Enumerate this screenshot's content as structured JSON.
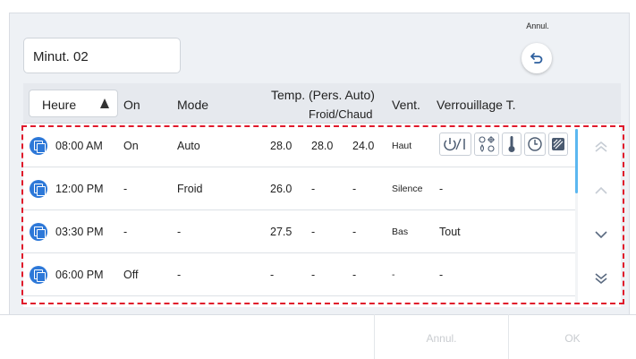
{
  "timer_name": "Minut. 02",
  "back": {
    "label": "Annul."
  },
  "header": {
    "sort_label": "Heure",
    "on": "On",
    "mode": "Mode",
    "temp_line1": "Temp. (Pers. Auto)",
    "temp_line2": "Froid/Chaud",
    "vent": "Vent.",
    "lock": "Verrouillage T."
  },
  "rows": [
    {
      "time": "08:00 AM",
      "on": "On",
      "mode": "Auto",
      "t1": "28.0",
      "t2": "28.0",
      "t3": "24.0",
      "vent": "Haut",
      "lock": ""
    },
    {
      "time": "12:00 PM",
      "on": "-",
      "mode": "Froid",
      "t1": "26.0",
      "t2": "-",
      "t3": "-",
      "vent": "Silence",
      "lock": "-"
    },
    {
      "time": "03:30 PM",
      "on": "-",
      "mode": "-",
      "t1": "27.5",
      "t2": "-",
      "t3": "-",
      "vent": "Bas",
      "lock": "Tout"
    },
    {
      "time": "06:00 PM",
      "on": "Off",
      "mode": "-",
      "t1": "-",
      "t2": "-",
      "t3": "-",
      "vent": "-",
      "lock": "-"
    }
  ],
  "lock_icons": [
    "power-icon",
    "mode-icon",
    "thermometer-icon",
    "timer-icon",
    "fan-icon"
  ],
  "footer": {
    "cancel": "Annul.",
    "ok": "OK"
  },
  "colors": {
    "accent": "#2d78d8",
    "scroll": "#5bb7f0",
    "highlight": "#e0192b"
  }
}
